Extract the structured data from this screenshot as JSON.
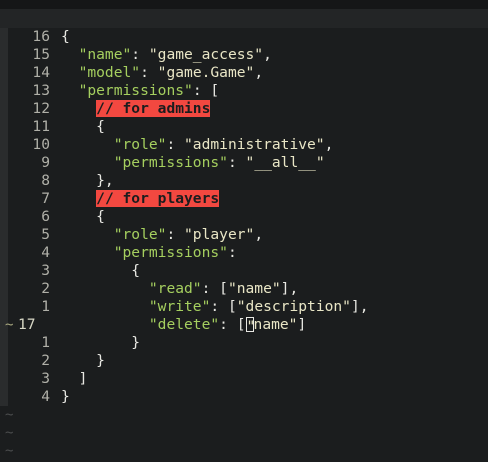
{
  "editor": {
    "cursor_line_marker": "~",
    "lines": [
      {
        "num": "16",
        "code": [
          {
            "t": "p",
            "v": "{"
          }
        ]
      },
      {
        "num": "15",
        "code": [
          {
            "t": "p",
            "v": "  "
          },
          {
            "t": "k",
            "v": "\"name\""
          },
          {
            "t": "p",
            "v": ": "
          },
          {
            "t": "s",
            "v": "\"game_access\""
          },
          {
            "t": "p",
            "v": ","
          }
        ]
      },
      {
        "num": "14",
        "code": [
          {
            "t": "p",
            "v": "  "
          },
          {
            "t": "k",
            "v": "\"model\""
          },
          {
            "t": "p",
            "v": ": "
          },
          {
            "t": "s",
            "v": "\"game.Game\""
          },
          {
            "t": "p",
            "v": ","
          }
        ]
      },
      {
        "num": "13",
        "code": [
          {
            "t": "p",
            "v": "  "
          },
          {
            "t": "k",
            "v": "\"permissions\""
          },
          {
            "t": "p",
            "v": ": ["
          }
        ]
      },
      {
        "num": "12",
        "code": [
          {
            "t": "p",
            "v": "    "
          },
          {
            "t": "comment",
            "v": "// for admins"
          }
        ]
      },
      {
        "num": "11",
        "code": [
          {
            "t": "p",
            "v": "    {"
          }
        ]
      },
      {
        "num": "10",
        "code": [
          {
            "t": "p",
            "v": "      "
          },
          {
            "t": "k",
            "v": "\"role\""
          },
          {
            "t": "p",
            "v": ": "
          },
          {
            "t": "s",
            "v": "\"administrative\""
          },
          {
            "t": "p",
            "v": ","
          }
        ]
      },
      {
        "num": "9",
        "code": [
          {
            "t": "p",
            "v": "      "
          },
          {
            "t": "k",
            "v": "\"permissions\""
          },
          {
            "t": "p",
            "v": ": "
          },
          {
            "t": "s",
            "v": "\"__all__\""
          }
        ]
      },
      {
        "num": "8",
        "code": [
          {
            "t": "p",
            "v": "    },"
          }
        ]
      },
      {
        "num": "7",
        "code": [
          {
            "t": "p",
            "v": "    "
          },
          {
            "t": "comment",
            "v": "// for players"
          }
        ]
      },
      {
        "num": "6",
        "code": [
          {
            "t": "p",
            "v": "    {"
          }
        ]
      },
      {
        "num": "5",
        "code": [
          {
            "t": "p",
            "v": "      "
          },
          {
            "t": "k",
            "v": "\"role\""
          },
          {
            "t": "p",
            "v": ": "
          },
          {
            "t": "s",
            "v": "\"player\""
          },
          {
            "t": "p",
            "v": ","
          }
        ]
      },
      {
        "num": "4",
        "code": [
          {
            "t": "p",
            "v": "      "
          },
          {
            "t": "k",
            "v": "\"permissions\""
          },
          {
            "t": "p",
            "v": ":"
          }
        ]
      },
      {
        "num": "3",
        "code": [
          {
            "t": "p",
            "v": "        {"
          }
        ]
      },
      {
        "num": "2",
        "code": [
          {
            "t": "p",
            "v": "          "
          },
          {
            "t": "k",
            "v": "\"read\""
          },
          {
            "t": "p",
            "v": ": ["
          },
          {
            "t": "s",
            "v": "\"name\""
          },
          {
            "t": "p",
            "v": "],"
          }
        ]
      },
      {
        "num": "1",
        "code": [
          {
            "t": "p",
            "v": "          "
          },
          {
            "t": "k",
            "v": "\"write\""
          },
          {
            "t": "p",
            "v": ": ["
          },
          {
            "t": "s",
            "v": "\"description\""
          },
          {
            "t": "p",
            "v": "],"
          }
        ]
      },
      {
        "num": "17",
        "current": true,
        "code": [
          {
            "t": "p",
            "v": "          "
          },
          {
            "t": "k",
            "v": "\"delete\""
          },
          {
            "t": "p",
            "v": ": ["
          },
          {
            "t": "cursor",
            "v": "\""
          },
          {
            "t": "s",
            "v": "name\""
          },
          {
            "t": "p",
            "v": "]"
          }
        ]
      },
      {
        "num": "1",
        "code": [
          {
            "t": "p",
            "v": "        }"
          }
        ]
      },
      {
        "num": "2",
        "code": [
          {
            "t": "p",
            "v": "    }"
          }
        ]
      },
      {
        "num": "3",
        "code": [
          {
            "t": "p",
            "v": "  ]"
          }
        ]
      },
      {
        "num": "4",
        "code": [
          {
            "t": "p",
            "v": "}"
          }
        ]
      }
    ],
    "empty_line_marker": "~",
    "empty_lines_count": 3
  },
  "colors": {
    "background": "#1b1d1e",
    "key": "#a5cf5f",
    "string": "#e9e6c6",
    "comment_bg": "#f24840"
  }
}
